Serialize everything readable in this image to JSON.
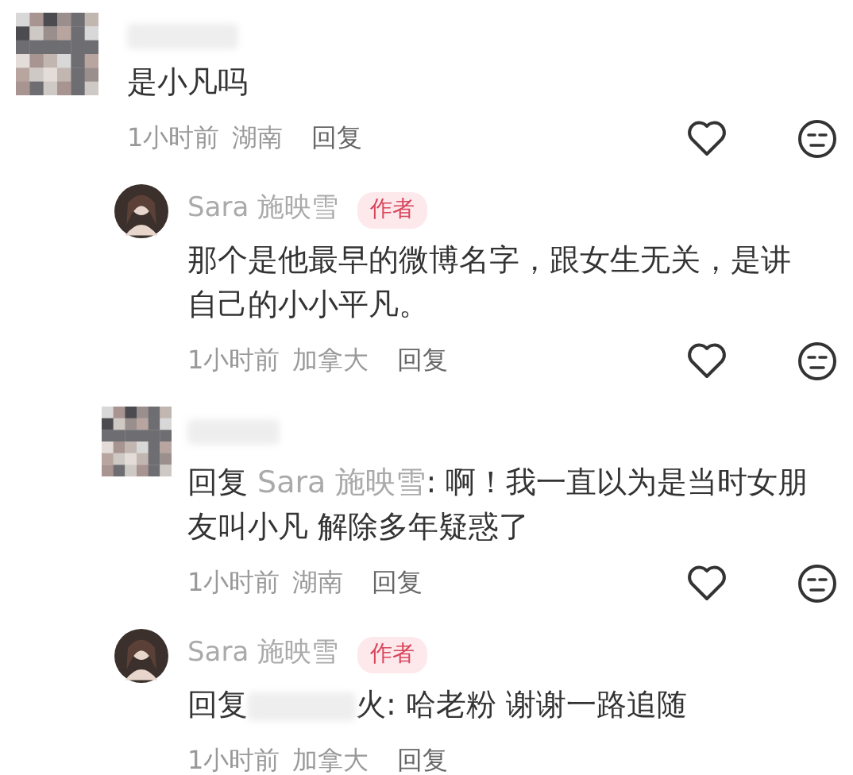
{
  "comments": [
    {
      "avatar": {
        "kind": "mosaic"
      },
      "name_hidden": true,
      "text": "是小凡吗",
      "time": "1小时前",
      "location": "湖南",
      "reply_label": "回复",
      "actions": true,
      "replies": [
        {
          "avatar": {
            "kind": "photo"
          },
          "name": "Sara 施映雪",
          "tag": "作者",
          "text": "那个是他最早的微博名字，跟女生无关，是讲自己的小小平凡。",
          "time": "1小时前",
          "location": "加拿大",
          "reply_label": "回复",
          "actions": true
        },
        {
          "avatar": {
            "kind": "mosaic"
          },
          "name_hidden": true,
          "reply_prefix": "回复",
          "mention": "Sara 施映雪",
          "text": ": 啊！我一直以为是当时女朋友叫小凡 解除多年疑惑了",
          "time": "1小时前",
          "location": "湖南",
          "reply_label": "回复",
          "actions": true
        },
        {
          "avatar": {
            "kind": "photo"
          },
          "name": "Sara 施映雪",
          "tag": "作者",
          "reply_prefix": "回复",
          "mention_hidden": true,
          "text": "火: 哈老粉  谢谢一路追随",
          "time": "1小时前",
          "location": "加拿大",
          "reply_label": "回复",
          "actions": false
        }
      ]
    }
  ]
}
